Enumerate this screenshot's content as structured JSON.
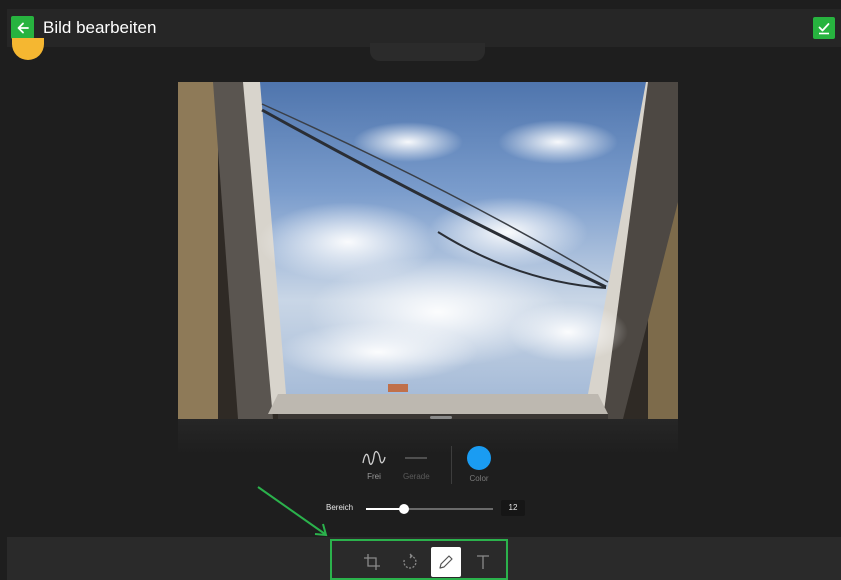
{
  "header": {
    "title": "Bild bearbeiten",
    "back_icon": "arrow-left-icon",
    "confirm_icon": "checkmark-icon",
    "accent": "#27b33f"
  },
  "draw_options": [
    {
      "label": "Frei",
      "icon": "freehand-wave-icon",
      "selected": true
    },
    {
      "label": "Gerade",
      "icon": "straight-line-icon",
      "selected": false
    },
    {
      "label": "Color",
      "icon": "color-swatch",
      "color": "#1a9cf2"
    }
  ],
  "slider": {
    "label": "Bereich",
    "value": "12",
    "fraction": 0.3
  },
  "toolbar": [
    {
      "name": "crop",
      "icon": "crop-icon",
      "active": false
    },
    {
      "name": "rotate",
      "icon": "rotate-icon",
      "active": false
    },
    {
      "name": "draw",
      "icon": "pencil-icon",
      "active": true
    },
    {
      "name": "text",
      "icon": "text-icon",
      "active": false
    }
  ],
  "annotation": {
    "highlight_color": "#2bb24c"
  }
}
